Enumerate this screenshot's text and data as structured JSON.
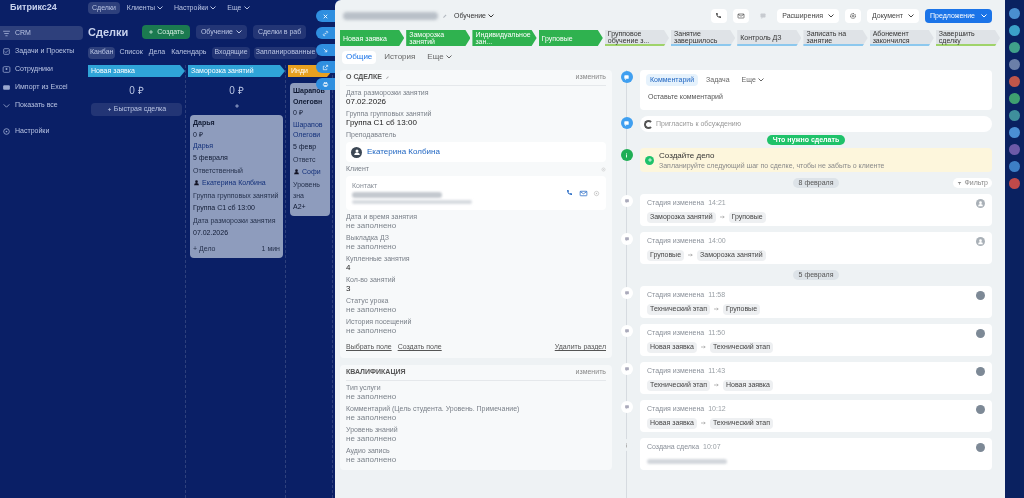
{
  "background_app": {
    "logo": "Битрикс24",
    "top_menu": [
      {
        "label": "Сделки",
        "selected": true,
        "has_menu": false
      },
      {
        "label": "Клиенты",
        "selected": false,
        "has_menu": true
      },
      {
        "label": "Настройки",
        "selected": false,
        "has_menu": true
      },
      {
        "label": "Еще",
        "selected": false,
        "has_menu": true
      }
    ],
    "sidebar": [
      {
        "label": "CRM",
        "kind": "crm",
        "selected": true
      },
      {
        "label": "Задачи и Проекты",
        "kind": "tasks",
        "selected": false
      },
      {
        "label": "Сотрудники",
        "kind": "people",
        "selected": false
      },
      {
        "label": "Импорт из Excel",
        "kind": "import",
        "selected": false
      },
      {
        "label": "Показать все",
        "kind": "more",
        "selected": false
      },
      {
        "label": "Настройки",
        "kind": "settings",
        "selected": false
      }
    ],
    "page_title": "Сделки",
    "create_button": "Создать",
    "filter": "Обучение",
    "search": "Сделки в раб",
    "view_tabs": [
      {
        "label": "Канбан",
        "selected": true
      },
      {
        "label": "Список",
        "selected": false
      },
      {
        "label": "Дела",
        "selected": false
      },
      {
        "label": "Календарь",
        "selected": false
      }
    ],
    "counters": [
      "Входящие",
      "Запланированные"
    ],
    "columns": [
      {
        "title": "Новая заявка",
        "color": "#2fa4d8",
        "sum": "0 ₽",
        "quick_add": "Быстрая сделка"
      },
      {
        "title": "Заморозка занятий",
        "color": "#2fa4d8",
        "sum": "0 ₽",
        "cards": [
          {
            "title": "Дарья",
            "amount": "0 ₽",
            "contact": "Дарья",
            "date": "5 февраля",
            "fields": [
              {
                "label": "Ответственный",
                "value": "Екатерина Колбина",
                "kind": "user"
              },
              {
                "label": "Группа групповых занятий",
                "value": "Группа С1 сб 13:00",
                "kind": "text"
              },
              {
                "label": "Дата разморозки занятия",
                "value": "07.02.2026",
                "kind": "text"
              }
            ],
            "add": "+ Дело",
            "time": "1 мин"
          }
        ]
      },
      {
        "title": "Инди",
        "color": "#e8a020",
        "cards": [
          {
            "title": "Шарапов Олеговн",
            "amount": "0 ₽",
            "contact": "Шарапов Олегови",
            "date": "5 февр",
            "fields": [
              {
                "label": "Ответс",
                "value": "Софи",
                "kind": "user"
              },
              {
                "label": "Уровень зна",
                "value": "A2+",
                "kind": "text"
              }
            ]
          }
        ]
      }
    ]
  },
  "deal": {
    "category": "Обучение",
    "header_buttons": [
      {
        "kind": "phone"
      },
      {
        "kind": "mail"
      },
      {
        "kind": "chat"
      },
      {
        "kind": "menu",
        "label": "Расширения"
      },
      {
        "kind": "gear"
      },
      {
        "kind": "menu",
        "label": "Документ"
      },
      {
        "kind": "primary",
        "label": "Предложение"
      }
    ],
    "stages": [
      {
        "label": "Новая заявка",
        "done": true,
        "color": "#2fb24f"
      },
      {
        "label": "Заморозка занятий",
        "done": true,
        "color": "#2fb24f"
      },
      {
        "label": "Индивидуальное зан...",
        "done": true,
        "color": "#2fb24f"
      },
      {
        "label": "Груповые",
        "done": true,
        "color": "#2fb24f"
      },
      {
        "label": "Групповое обучение з...",
        "done": false,
        "color": "#9fd36a"
      },
      {
        "label": "Занятие завершилось",
        "done": false,
        "color": "#8cc8ee"
      },
      {
        "label": "Контроль ДЗ",
        "done": false,
        "color": "#8cc8ee"
      },
      {
        "label": "Записать на занятие",
        "done": false,
        "color": "#8cc8ee"
      },
      {
        "label": "Абонемент закончился",
        "done": false,
        "color": "#8cc8ee"
      },
      {
        "label": "Завершить сделку",
        "done": false,
        "color": "#9fd36a"
      }
    ],
    "tabs": [
      {
        "label": "Общие",
        "selected": true
      },
      {
        "label": "История",
        "selected": false
      },
      {
        "label": "Еще",
        "selected": false
      }
    ],
    "sections": [
      {
        "title": "О СДЕЛКЕ",
        "action": "изменить",
        "fields": [
          {
            "kind": "text",
            "label": "Дата разморозки занятия",
            "value": "07.02.2026",
            "empty": false
          },
          {
            "kind": "text",
            "label": "Группа групповых занятий",
            "value": "Группа С1 сб 13:00",
            "empty": false
          },
          {
            "kind": "user",
            "label": "Преподаватель",
            "value": "Екатерина Колбина"
          },
          {
            "kind": "client",
            "label": "Клиент",
            "contact_label": "Контакт"
          },
          {
            "kind": "text",
            "label": "Дата и время занятия",
            "value": "не заполнено",
            "empty": true
          },
          {
            "kind": "text",
            "label": "Выкладка ДЗ",
            "value": "не заполнено",
            "empty": true
          },
          {
            "kind": "text",
            "label": "Купленные занятия",
            "value": "4",
            "empty": false
          },
          {
            "kind": "text",
            "label": "Кол-во занятий",
            "value": "3",
            "empty": false
          },
          {
            "kind": "text",
            "label": "Статус урока",
            "value": "не заполнено",
            "empty": true
          },
          {
            "kind": "text",
            "label": "История посещений",
            "value": "не заполнено",
            "empty": true
          }
        ],
        "links": [
          "Выбрать поле",
          "Создать поле"
        ],
        "delete_link": "Удалить раздел"
      },
      {
        "title": "КВАЛИФИКАЦИЯ",
        "action": "изменить",
        "fields": [
          {
            "kind": "text",
            "label": "Тип услуги",
            "value": "не заполнено",
            "empty": true
          },
          {
            "kind": "text",
            "label": "Комментарий (Цель студента. Уровень. Примечание)",
            "value": "не заполнено",
            "empty": true
          },
          {
            "kind": "text",
            "label": "Уровень знаний",
            "value": "не заполнено",
            "empty": true
          },
          {
            "kind": "text",
            "label": "Аудио запись",
            "value": "не заполнено",
            "empty": true
          }
        ]
      }
    ],
    "timeline": {
      "composer_tabs": [
        {
          "label": "Комментарий",
          "selected": true
        },
        {
          "label": "Задача",
          "selected": false
        },
        {
          "label": "Еще",
          "selected": false
        }
      ],
      "composer_placeholder": "Оставьте комментарий",
      "discussion_placeholder": "Пригласить к обсуждению",
      "todo_badge": "Что нужно сделать",
      "create_task": {
        "title": "Создайте дело",
        "text": "Запланируйте следующий шаг по сделке, чтобы не забыть о клиенте"
      },
      "filter": "Фильтр",
      "groups": [
        {
          "date": "8 февраля",
          "events": [
            {
              "kind": "stage",
              "title": "Стадия изменена",
              "time": "14:21",
              "from": "Заморозка занятий",
              "to": "Груповые",
              "avatar": {
                "kind": "person"
              }
            },
            {
              "kind": "stage",
              "title": "Стадия изменена",
              "time": "14:00",
              "from": "Груповые",
              "to": "Заморозка занятий",
              "avatar": {
                "kind": "person"
              }
            }
          ]
        },
        {
          "date": "5 февраля",
          "events": [
            {
              "kind": "stage",
              "title": "Стадия изменена",
              "time": "11:58",
              "from": "Технический этап",
              "to": "Груповые",
              "avatar": {
                "kind": "photo"
              }
            },
            {
              "kind": "stage",
              "title": "Стадия изменена",
              "time": "11:50",
              "from": "Новая заявка",
              "to": "Технический этап",
              "avatar": {
                "kind": "photo"
              }
            },
            {
              "kind": "stage",
              "title": "Стадия изменена",
              "time": "11:43",
              "from": "Технический этап",
              "to": "Новая заявка",
              "avatar": {
                "kind": "photo"
              }
            },
            {
              "kind": "stage",
              "title": "Стадия изменена",
              "time": "10:12",
              "from": "Новая заявка",
              "to": "Технический этап",
              "avatar": {
                "kind": "photo"
              }
            },
            {
              "kind": "created",
              "title": "Создана сделка",
              "time": "10:07",
              "avatar": {
                "kind": "photo"
              }
            }
          ]
        }
      ]
    }
  }
}
